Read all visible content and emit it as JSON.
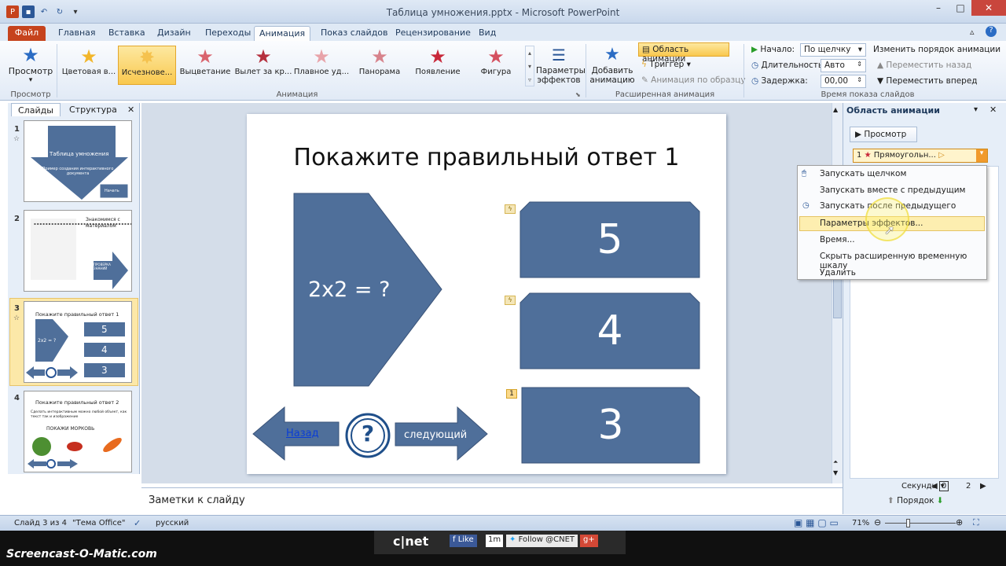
{
  "window": {
    "title": "Таблица умножения.pptx - Microsoft PowerPoint"
  },
  "tabs": [
    "Файл",
    "Главная",
    "Вставка",
    "Дизайн",
    "Переходы",
    "Анимация",
    "Показ слайдов",
    "Рецензирование",
    "Вид"
  ],
  "ribbon": {
    "preview": "Просмотр",
    "preview_group": "Просмотр",
    "animations": [
      "Цветовая в...",
      "Исчезнове...",
      "Выцветание",
      "Вылет за кр...",
      "Плавное уд...",
      "Панорама",
      "Появление",
      "Фигура"
    ],
    "anim_group": "Анимация",
    "effect_params": [
      "Параметры",
      "эффектов"
    ],
    "add_anim": [
      "Добавить",
      "анимацию"
    ],
    "anim_area": "Область анимации",
    "trigger": "Триггер",
    "anim_painter": "Анимация по образцу",
    "adv_group": "Расширенная анимация",
    "start_label": "Начало:",
    "start_value": "По щелчку",
    "duration_label": "Длительность:",
    "duration_value": "Авто",
    "delay_label": "Задержка:",
    "delay_value": "00,00",
    "reorder": "Изменить порядок анимации",
    "move_back": "Переместить назад",
    "move_fwd": "Переместить вперед",
    "timing_group": "Время показа слайдов"
  },
  "leftpane": {
    "tab_slides": "Слайды",
    "tab_outline": "Структура",
    "slides": [
      {
        "num": "1",
        "title": "Таблица умножения",
        "subtitle": "Пример создания интерактивного документа",
        "btn": "Начать"
      },
      {
        "num": "2",
        "text": "Знакомимся с материалом",
        "arrow": "ПРОВЕРКА ЗНАНИЙ"
      },
      {
        "num": "3",
        "title": "Покажите правильный ответ 1",
        "q": "2x2 = ?",
        "a": [
          "5",
          "4",
          "3"
        ]
      },
      {
        "num": "4",
        "title": "Покажите правильный ответ 2",
        "bullet": "Сделать интерактивным можно любой объект, как текст так и изображение",
        "sub": "ПОКАЖИ МОРКОВЬ"
      }
    ]
  },
  "slide": {
    "title": "Покажите правильный ответ 1",
    "question": "2x2 = ?",
    "answers": [
      "5",
      "4",
      "3"
    ],
    "back": "Назад",
    "next": "следующий",
    "q_mark": "?",
    "order_tag": "1"
  },
  "notes": {
    "placeholder": "Заметки к слайду"
  },
  "animpane": {
    "title": "Область анимации",
    "play": "Просмотр",
    "item_num": "1",
    "item_label": "Прямоугольн...",
    "seconds": "Секунды",
    "timeline": [
      "0",
      "2"
    ],
    "order": "Порядок"
  },
  "menu": {
    "items": [
      "Запускать щелчком",
      "Запускать вместе с предыдущим",
      "Запускать после предыдущего",
      "Параметры эффектов...",
      "Время...",
      "Скрыть расширенную временную шкалу",
      "Удалить"
    ]
  },
  "status": {
    "slide": "Слайд 3 из 4",
    "theme": "\"Тема Office\"",
    "lang": "русский",
    "zoom": "71%"
  },
  "overlay": {
    "watermark": "Screencast-O-Matic.com",
    "brand": "c|net",
    "like": "Like",
    "count": "1m",
    "follow": "Follow @CNET",
    "gplus": "g+"
  },
  "colors": {
    "shape": "#4f6f9a",
    "shape_stroke": "#3a5378",
    "accent": "#c6431d",
    "highlight": "#fde8a0"
  }
}
